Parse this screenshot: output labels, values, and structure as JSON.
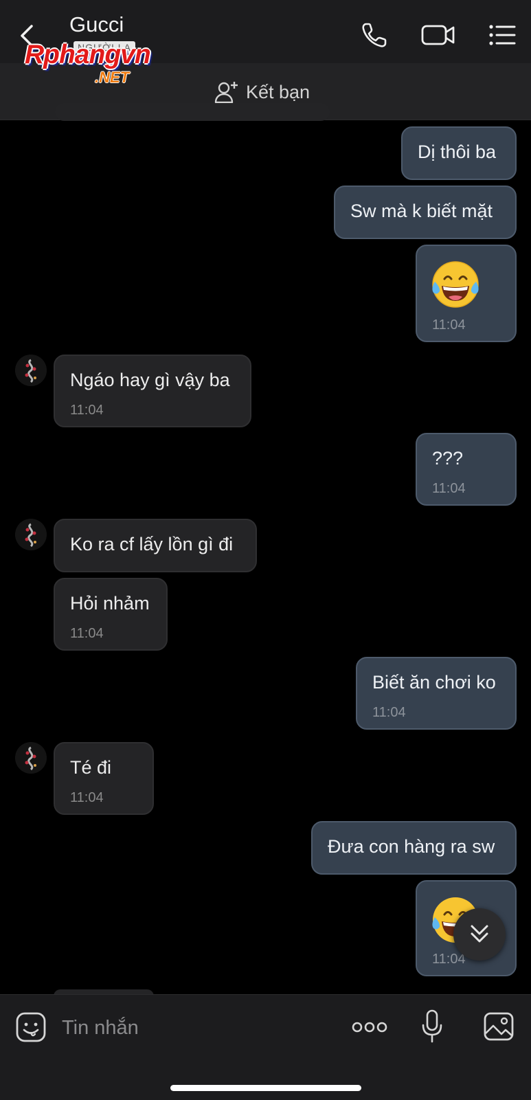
{
  "header": {
    "contact_name": "Gucci",
    "contact_status": "NGƯỜI LẠ",
    "watermark_main": "Rphangvn",
    "watermark_sub": ".NET"
  },
  "add_friend": {
    "label": "Kết bạn"
  },
  "messages": [
    {
      "direction": "out",
      "text": "Dị thôi ba"
    },
    {
      "direction": "out",
      "text": "Sw mà k biết mặt"
    },
    {
      "direction": "out",
      "emoji": "laughing-tears-emoji",
      "time": "11:04"
    },
    {
      "direction": "in",
      "text": "Ngáo hay gì vậy ba",
      "time": "11:04"
    },
    {
      "direction": "out",
      "text": "???",
      "time": "11:04"
    },
    {
      "direction": "in",
      "text": "Ko ra cf lấy lồn gì đi"
    },
    {
      "direction": "in",
      "text": "Hỏi nhảm",
      "time": "11:04"
    },
    {
      "direction": "out",
      "text": "Biết ăn chơi ko",
      "time": "11:04"
    },
    {
      "direction": "in",
      "text": "Té đi",
      "time": "11:04"
    },
    {
      "direction": "out",
      "text": "Đưa con hàng ra sw"
    },
    {
      "direction": "out",
      "emoji": "laughing-tears-emoji",
      "time": "11:04"
    }
  ],
  "composer": {
    "placeholder": "Tin nhắn"
  },
  "colors": {
    "background": "#000000",
    "outgoing_bubble": "#36414f",
    "incoming_bubble": "#242426",
    "header": "#1c1c1e"
  }
}
